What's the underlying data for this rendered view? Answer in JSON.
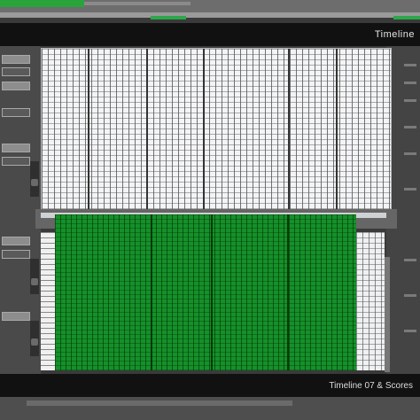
{
  "window": {
    "title": "Timeline",
    "status_text": "Timeline 07 & Scores"
  },
  "colors": {
    "accent": "#28a43a",
    "selection_fill": "#15902a",
    "grid_background": "#f2f4f6",
    "chrome": "#111111"
  },
  "icons": [
    "panel-button",
    "scroll-knob",
    "grid-line"
  ]
}
